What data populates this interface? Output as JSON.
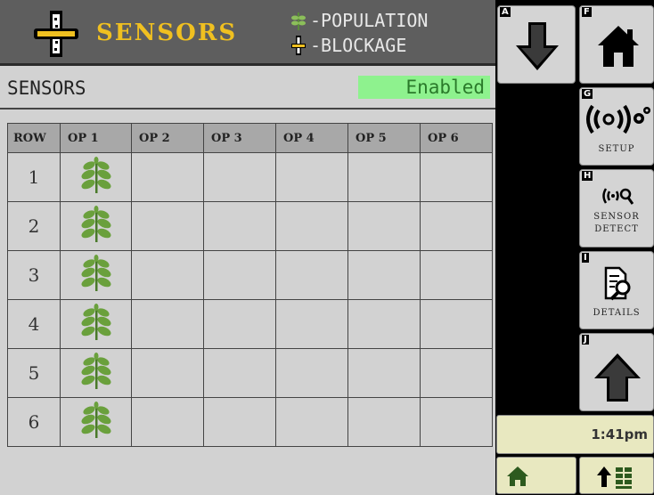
{
  "header": {
    "title": "SENSORS",
    "legend": [
      {
        "icon": "plant-population-icon",
        "label": "-POPULATION"
      },
      {
        "icon": "sensor-blockage-icon",
        "label": "-BLOCKAGE"
      }
    ]
  },
  "status": {
    "label": "SENSORS",
    "value": "Enabled"
  },
  "table": {
    "row_header": "ROW",
    "columns": [
      "OP 1",
      "OP 2",
      "OP 3",
      "OP 4",
      "OP 5",
      "OP 6"
    ],
    "rows": [
      {
        "num": "1",
        "cells": [
          "plant",
          "",
          "",
          "",
          "",
          ""
        ]
      },
      {
        "num": "2",
        "cells": [
          "plant",
          "",
          "",
          "",
          "",
          ""
        ]
      },
      {
        "num": "3",
        "cells": [
          "plant",
          "",
          "",
          "",
          "",
          ""
        ]
      },
      {
        "num": "4",
        "cells": [
          "plant",
          "",
          "",
          "",
          "",
          ""
        ]
      },
      {
        "num": "5",
        "cells": [
          "plant",
          "",
          "",
          "",
          "",
          ""
        ]
      },
      {
        "num": "6",
        "cells": [
          "plant",
          "",
          "",
          "",
          "",
          ""
        ]
      }
    ]
  },
  "softkeys": {
    "a": {
      "key": "A",
      "icon": "arrow-down-icon"
    },
    "f": {
      "key": "F",
      "icon": "home-icon"
    },
    "g": {
      "key": "G",
      "icon": "setup-icon",
      "label": "SETUP"
    },
    "h": {
      "key": "H",
      "icon": "sensor-detect-icon",
      "label1": "SENSOR",
      "label2": "DETECT"
    },
    "i": {
      "key": "I",
      "icon": "details-icon",
      "label": "DETAILS"
    },
    "j": {
      "key": "J",
      "icon": "arrow-up-icon"
    }
  },
  "clock": "1:41pm",
  "bottom": {
    "home_icon": "home-icon",
    "menu_icon": "run-page-menu-icon"
  },
  "colors": {
    "header_bg": "#5e5e5e",
    "title_yellow": "#f0c020",
    "enabled_bg": "#8ef28e",
    "plant_green": "#6aa03c"
  }
}
